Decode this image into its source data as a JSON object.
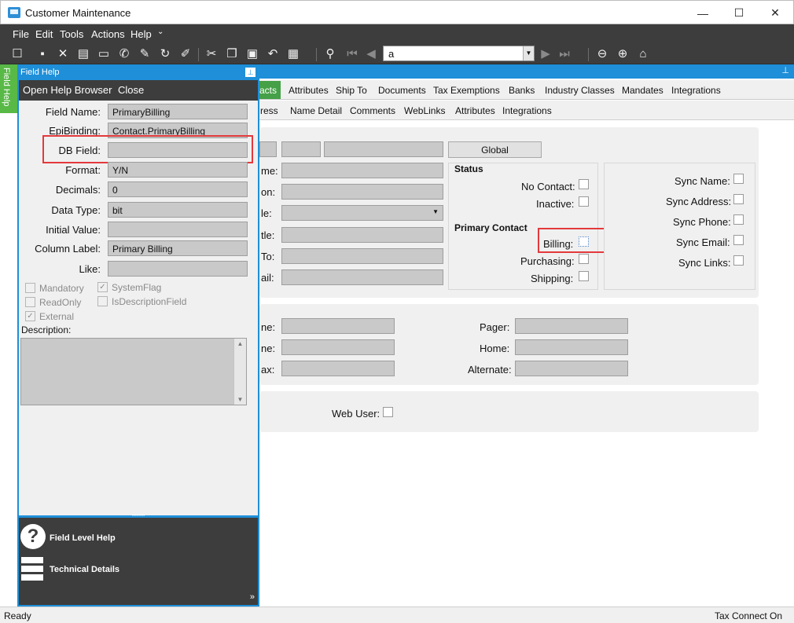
{
  "window": {
    "title": "Customer Maintenance",
    "minimize": "—",
    "maximize": "☐",
    "close": "✕"
  },
  "menu": [
    "File",
    "Edit",
    "Tools",
    "Actions",
    "Help"
  ],
  "toolbar": {
    "search_value": "a"
  },
  "main_tabs": [
    "acts",
    "Attributes",
    "Ship To",
    "Documents",
    "Tax Exemptions",
    "Banks",
    "Industry Classes",
    "Mandates",
    "Integrations"
  ],
  "sub_tabs": [
    "ress",
    "Name Detail",
    "Comments",
    "WebLinks",
    "Attributes",
    "Integrations"
  ],
  "contact": {
    "global_button": "Global",
    "left_labels": [
      "me:",
      "on:",
      "le:",
      "tle:",
      "To:",
      "ail:"
    ],
    "status_title": "Status",
    "no_contact": "No Contact:",
    "inactive": "Inactive:",
    "primary_contact_title": "Primary Contact",
    "billing": "Billing:",
    "purchasing": "Purchasing:",
    "shipping": "Shipping:",
    "sync_name": "Sync Name:",
    "sync_address": "Sync Address:",
    "sync_phone": "Sync Phone:",
    "sync_email": "Sync Email:",
    "sync_links": "Sync Links:"
  },
  "phones": {
    "left_labels": [
      "ne:",
      "ne:",
      "ax:"
    ],
    "pager": "Pager:",
    "home": "Home:",
    "alternate": "Alternate:"
  },
  "web_user": "Web User:",
  "field_help": {
    "vertical_tab": "Field Help",
    "header": "Field Help",
    "menu_open": "Open Help Browser",
    "menu_close": "Close",
    "labels": {
      "field_name": "Field Name:",
      "epibinding": "EpiBinding:",
      "db_field": "DB Field:",
      "format": "Format:",
      "decimals": "Decimals:",
      "data_type": "Data Type:",
      "initial_value": "Initial Value:",
      "column_label": "Column Label:",
      "like": "Like:"
    },
    "values": {
      "field_name": "PrimaryBilling",
      "epibinding": "Contact.PrimaryBilling",
      "db_field": "",
      "format": "Y/N",
      "decimals": "0",
      "data_type": "bit",
      "initial_value": "",
      "column_label": "Primary Billing",
      "like": ""
    },
    "checks": {
      "mandatory": "Mandatory",
      "readonly": "ReadOnly",
      "external": "External",
      "systemflag": "SystemFlag",
      "isdescriptionfield": "IsDescriptionField"
    },
    "description_label": "Description:",
    "nav_field_level_help": "Field Level Help",
    "nav_technical_details": "Technical Details"
  },
  "status": {
    "left": "Ready",
    "right": "Tax Connect On"
  },
  "colors": {
    "accent_blue": "#1e8fd8",
    "active_tab_green": "#45a047",
    "toolbar_dark": "#3d3d3d",
    "highlight_red": "#e3393c"
  }
}
